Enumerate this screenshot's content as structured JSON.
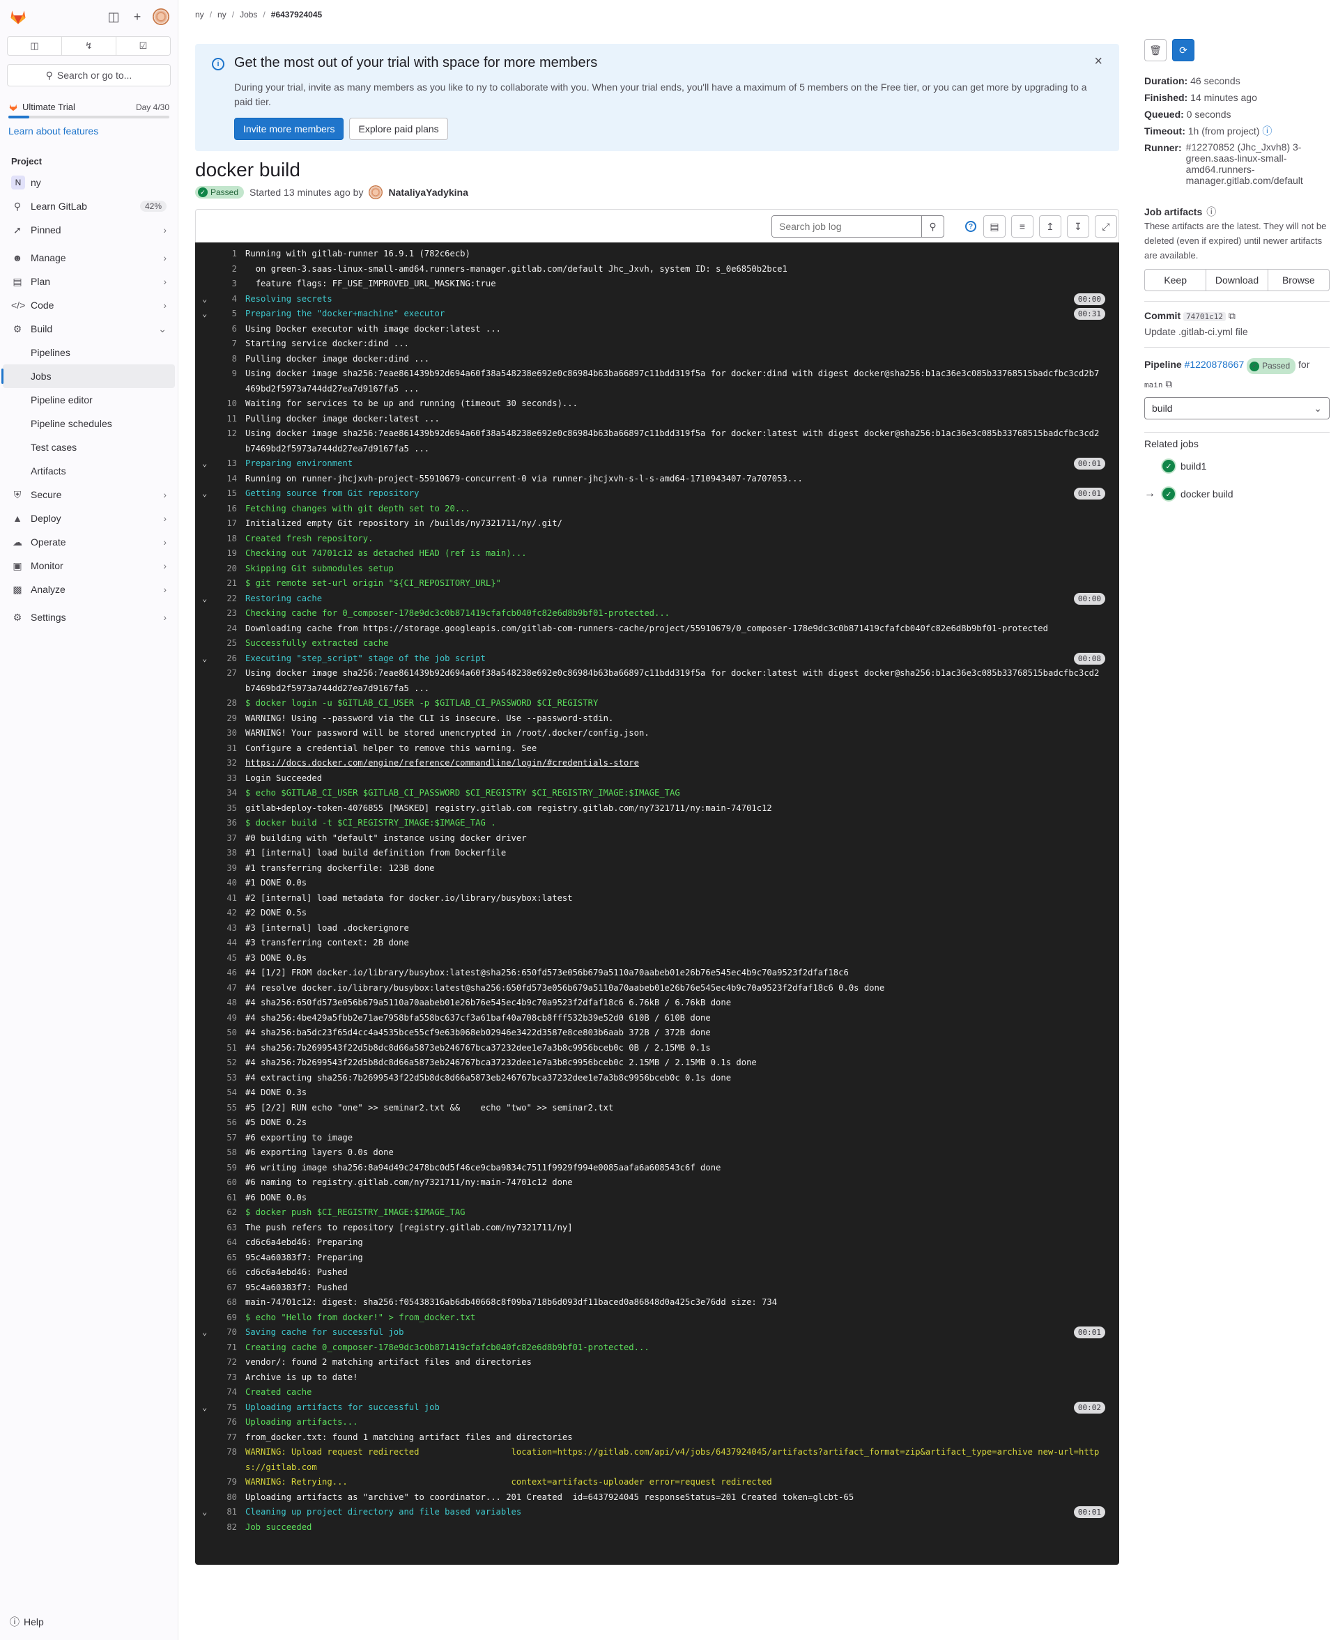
{
  "sidebar": {
    "search_label": "Search or go to...",
    "counts": [
      "issues-icon",
      "merge-request-icon",
      "todo-icon"
    ],
    "trial_label": "Ultimate Trial",
    "trial_day": "Day 4/30",
    "trial_progress": 0.13,
    "learn_link": "Learn about features",
    "section": "Project",
    "project_name": "ny",
    "project_initial": "N",
    "learn_gitlab": "Learn GitLab",
    "learn_gitlab_pct": "42%",
    "pinned": "Pinned",
    "manage": "Manage",
    "plan": "Plan",
    "code": "Code",
    "build": "Build",
    "build_items": [
      "Pipelines",
      "Jobs",
      "Pipeline editor",
      "Pipeline schedules",
      "Test cases",
      "Artifacts"
    ],
    "secure": "Secure",
    "deploy": "Deploy",
    "operate": "Operate",
    "monitor": "Monitor",
    "analyze": "Analyze",
    "settings": "Settings",
    "help": "Help"
  },
  "breadcrumbs": [
    "ny",
    "ny",
    "Jobs",
    "#6437924045"
  ],
  "banner": {
    "title": "Get the most out of your trial with space for more members",
    "body": "During your trial, invite as many members as you like to ny to collaborate with you. When your trial ends, you'll have a maximum of 5 members on the Free tier, or you can get more by upgrading to a paid tier.",
    "primary": "Invite more members",
    "secondary": "Explore paid plans"
  },
  "job": {
    "title": "docker build",
    "status": "Passed",
    "started": "Started 13 minutes ago by",
    "user": "NataliyaYadykina",
    "search_placeholder": "Search job log"
  },
  "log": [
    {
      "n": 1,
      "t": "Running with gitlab-runner 16.9.1 (782c6ecb)"
    },
    {
      "n": 2,
      "t": "  on green-3.saas-linux-small-amd64.runners-manager.gitlab.com/default Jhc_Jxvh, system ID: s_0e6850b2bce1"
    },
    {
      "n": 3,
      "t": "  feature flags: FF_USE_IMPROVED_URL_MASKING:true"
    },
    {
      "n": 4,
      "t": "Resolving secrets",
      "c": "cyan",
      "sec": true,
      "d": "00:00"
    },
    {
      "n": 5,
      "t": "Preparing the \"docker+machine\" executor",
      "c": "cyan",
      "sec": true,
      "d": "00:31"
    },
    {
      "n": 6,
      "t": "Using Docker executor with image docker:latest ..."
    },
    {
      "n": 7,
      "t": "Starting service docker:dind ..."
    },
    {
      "n": 8,
      "t": "Pulling docker image docker:dind ..."
    },
    {
      "n": 9,
      "t": "Using docker image sha256:7eae861439b92d694a60f38a548238e692e0c86984b63ba66897c11bdd319f5a for docker:dind with digest docker@sha256:b1ac36e3c085b33768515badcfbc3cd2b7469bd2f5973a744dd27ea7d9167fa5 ..."
    },
    {
      "n": 10,
      "t": "Waiting for services to be up and running (timeout 30 seconds)..."
    },
    {
      "n": 11,
      "t": "Pulling docker image docker:latest ..."
    },
    {
      "n": 12,
      "t": "Using docker image sha256:7eae861439b92d694a60f38a548238e692e0c86984b63ba66897c11bdd319f5a for docker:latest with digest docker@sha256:b1ac36e3c085b33768515badcfbc3cd2b7469bd2f5973a744dd27ea7d9167fa5 ..."
    },
    {
      "n": 13,
      "t": "Preparing environment",
      "c": "cyan",
      "sec": true,
      "d": "00:01"
    },
    {
      "n": 14,
      "t": "Running on runner-jhcjxvh-project-55910679-concurrent-0 via runner-jhcjxvh-s-l-s-amd64-1710943407-7a707053..."
    },
    {
      "n": 15,
      "t": "Getting source from Git repository",
      "c": "cyan",
      "sec": true,
      "d": "00:01"
    },
    {
      "n": 16,
      "t": "Fetching changes with git depth set to 20...",
      "c": "green"
    },
    {
      "n": 17,
      "t": "Initialized empty Git repository in /builds/ny7321711/ny/.git/"
    },
    {
      "n": 18,
      "t": "Created fresh repository.",
      "c": "green"
    },
    {
      "n": 19,
      "t": "Checking out 74701c12 as detached HEAD (ref is main)...",
      "c": "green"
    },
    {
      "n": 20,
      "t": "Skipping Git submodules setup",
      "c": "green"
    },
    {
      "n": 21,
      "t": "$ git remote set-url origin \"${CI_REPOSITORY_URL}\"",
      "c": "green"
    },
    {
      "n": 22,
      "t": "Restoring cache",
      "c": "cyan",
      "sec": true,
      "d": "00:00"
    },
    {
      "n": 23,
      "t": "Checking cache for 0_composer-178e9dc3c0b871419cfafcb040fc82e6d8b9bf01-protected...",
      "c": "green"
    },
    {
      "n": 24,
      "t": "Downloading cache from https://storage.googleapis.com/gitlab-com-runners-cache/project/55910679/0_composer-178e9dc3c0b871419cfafcb040fc82e6d8b9bf01-protected"
    },
    {
      "n": 25,
      "t": "Successfully extracted cache",
      "c": "green"
    },
    {
      "n": 26,
      "t": "Executing \"step_script\" stage of the job script",
      "c": "cyan",
      "sec": true,
      "d": "00:08"
    },
    {
      "n": 27,
      "t": "Using docker image sha256:7eae861439b92d694a60f38a548238e692e0c86984b63ba66897c11bdd319f5a for docker:latest with digest docker@sha256:b1ac36e3c085b33768515badcfbc3cd2b7469bd2f5973a744dd27ea7d9167fa5 ..."
    },
    {
      "n": 28,
      "t": "$ docker login -u $GITLAB_CI_USER -p $GITLAB_CI_PASSWORD $CI_REGISTRY",
      "c": "green"
    },
    {
      "n": 29,
      "t": "WARNING! Using --password via the CLI is insecure. Use --password-stdin."
    },
    {
      "n": 30,
      "t": "WARNING! Your password will be stored unencrypted in /root/.docker/config.json."
    },
    {
      "n": 31,
      "t": "Configure a credential helper to remove this warning. See"
    },
    {
      "n": 32,
      "t": "https://docs.docker.com/engine/reference/commandline/login/#credentials-store",
      "u": true
    },
    {
      "n": 33,
      "t": "Login Succeeded"
    },
    {
      "n": 34,
      "t": "$ echo $GITLAB_CI_USER $GITLAB_CI_PASSWORD $CI_REGISTRY $CI_REGISTRY_IMAGE:$IMAGE_TAG",
      "c": "green"
    },
    {
      "n": 35,
      "t": "gitlab+deploy-token-4076855 [MASKED] registry.gitlab.com registry.gitlab.com/ny7321711/ny:main-74701c12"
    },
    {
      "n": 36,
      "t": "$ docker build -t $CI_REGISTRY_IMAGE:$IMAGE_TAG .",
      "c": "green"
    },
    {
      "n": 37,
      "t": "#0 building with \"default\" instance using docker driver"
    },
    {
      "n": 38,
      "t": "#1 [internal] load build definition from Dockerfile"
    },
    {
      "n": 39,
      "t": "#1 transferring dockerfile: 123B done"
    },
    {
      "n": 40,
      "t": "#1 DONE 0.0s"
    },
    {
      "n": 41,
      "t": "#2 [internal] load metadata for docker.io/library/busybox:latest"
    },
    {
      "n": 42,
      "t": "#2 DONE 0.5s"
    },
    {
      "n": 43,
      "t": "#3 [internal] load .dockerignore"
    },
    {
      "n": 44,
      "t": "#3 transferring context: 2B done"
    },
    {
      "n": 45,
      "t": "#3 DONE 0.0s"
    },
    {
      "n": 46,
      "t": "#4 [1/2] FROM docker.io/library/busybox:latest@sha256:650fd573e056b679a5110a70aabeb01e26b76e545ec4b9c70a9523f2dfaf18c6"
    },
    {
      "n": 47,
      "t": "#4 resolve docker.io/library/busybox:latest@sha256:650fd573e056b679a5110a70aabeb01e26b76e545ec4b9c70a9523f2dfaf18c6 0.0s done"
    },
    {
      "n": 48,
      "t": "#4 sha256:650fd573e056b679a5110a70aabeb01e26b76e545ec4b9c70a9523f2dfaf18c6 6.76kB / 6.76kB done"
    },
    {
      "n": 49,
      "t": "#4 sha256:4be429a5fbb2e71ae7958bfa558bc637cf3a61baf40a708cb8fff532b39e52d0 610B / 610B done"
    },
    {
      "n": 50,
      "t": "#4 sha256:ba5dc23f65d4cc4a4535bce55cf9e63b068eb02946e3422d3587e8ce803b6aab 372B / 372B done"
    },
    {
      "n": 51,
      "t": "#4 sha256:7b2699543f22d5b8dc8d66a5873eb246767bca37232dee1e7a3b8c9956bceb0c 0B / 2.15MB 0.1s"
    },
    {
      "n": 52,
      "t": "#4 sha256:7b2699543f22d5b8dc8d66a5873eb246767bca37232dee1e7a3b8c9956bceb0c 2.15MB / 2.15MB 0.1s done"
    },
    {
      "n": 53,
      "t": "#4 extracting sha256:7b2699543f22d5b8dc8d66a5873eb246767bca37232dee1e7a3b8c9956bceb0c 0.1s done"
    },
    {
      "n": 54,
      "t": "#4 DONE 0.3s"
    },
    {
      "n": 55,
      "t": "#5 [2/2] RUN echo \"one\" >> seminar2.txt &&    echo \"two\" >> seminar2.txt"
    },
    {
      "n": 56,
      "t": "#5 DONE 0.2s"
    },
    {
      "n": 57,
      "t": "#6 exporting to image"
    },
    {
      "n": 58,
      "t": "#6 exporting layers 0.0s done"
    },
    {
      "n": 59,
      "t": "#6 writing image sha256:8a94d49c2478bc0d5f46ce9cba9834c7511f9929f994e0085aafa6a608543c6f done"
    },
    {
      "n": 60,
      "t": "#6 naming to registry.gitlab.com/ny7321711/ny:main-74701c12 done"
    },
    {
      "n": 61,
      "t": "#6 DONE 0.0s"
    },
    {
      "n": 62,
      "t": "$ docker push $CI_REGISTRY_IMAGE:$IMAGE_TAG",
      "c": "green"
    },
    {
      "n": 63,
      "t": "The push refers to repository [registry.gitlab.com/ny7321711/ny]"
    },
    {
      "n": 64,
      "t": "cd6c6a4ebd46: Preparing"
    },
    {
      "n": 65,
      "t": "95c4a60383f7: Preparing"
    },
    {
      "n": 66,
      "t": "cd6c6a4ebd46: Pushed"
    },
    {
      "n": 67,
      "t": "95c4a60383f7: Pushed"
    },
    {
      "n": 68,
      "t": "main-74701c12: digest: sha256:f05438316ab6db40668c8f09ba718b6d093df11baced0a86848d0a425c3e76dd size: 734"
    },
    {
      "n": 69,
      "t": "$ echo \"Hello from docker!\" > from_docker.txt",
      "c": "green"
    },
    {
      "n": 70,
      "t": "Saving cache for successful job",
      "c": "cyan",
      "sec": true,
      "d": "00:01"
    },
    {
      "n": 71,
      "t": "Creating cache 0_composer-178e9dc3c0b871419cfafcb040fc82e6d8b9bf01-protected...",
      "c": "green"
    },
    {
      "n": 72,
      "t": "vendor/: found 2 matching artifact files and directories"
    },
    {
      "n": 73,
      "t": "Archive is up to date!"
    },
    {
      "n": 74,
      "t": "Created cache",
      "c": "green"
    },
    {
      "n": 75,
      "t": "Uploading artifacts for successful job",
      "c": "cyan",
      "sec": true,
      "d": "00:02"
    },
    {
      "n": 76,
      "t": "Uploading artifacts...",
      "c": "green"
    },
    {
      "n": 77,
      "t": "from_docker.txt: found 1 matching artifact files and directories"
    },
    {
      "n": 78,
      "t": "WARNING: Upload request redirected                  location=https://gitlab.com/api/v4/jobs/6437924045/artifacts?artifact_format=zip&artifact_type=archive new-url=https://gitlab.com",
      "c": "yellow"
    },
    {
      "n": 79,
      "t": "WARNING: Retrying...                                context=artifacts-uploader error=request redirected",
      "c": "yellow"
    },
    {
      "n": 80,
      "t": "Uploading artifacts as \"archive\" to coordinator... 201 Created  id=6437924045 responseStatus=201 Created token=glcbt-65"
    },
    {
      "n": 81,
      "t": "Cleaning up project directory and file based variables",
      "c": "cyan",
      "sec": true,
      "d": "00:01"
    },
    {
      "n": 82,
      "t": "Job succeeded",
      "c": "green"
    }
  ],
  "right": {
    "duration_label": "Duration:",
    "duration": "46 seconds",
    "finished_label": "Finished:",
    "finished": "14 minutes ago",
    "queued_label": "Queued:",
    "queued": "0 seconds",
    "timeout_label": "Timeout:",
    "timeout": "1h (from project)",
    "runner_label": "Runner:",
    "runner": "#12270852 (Jhc_Jxvh8) 3-green.saas-linux-small-amd64.runners-manager.gitlab.com/default",
    "artifacts_title": "Job artifacts",
    "artifacts_text": "These artifacts are the latest. They will not be deleted (even if expired) until newer artifacts are available.",
    "keep": "Keep",
    "download": "Download",
    "browse": "Browse",
    "commit_label": "Commit",
    "commit_sha": "74701c12",
    "commit_msg": "Update .gitlab-ci.yml file",
    "pipeline_label": "Pipeline",
    "pipeline_id": "#1220878667",
    "pipeline_status": "Passed",
    "pipeline_for": "for",
    "pipeline_ref": "main",
    "stage": "build",
    "related_title": "Related jobs",
    "related": [
      "build1",
      "docker build"
    ]
  }
}
